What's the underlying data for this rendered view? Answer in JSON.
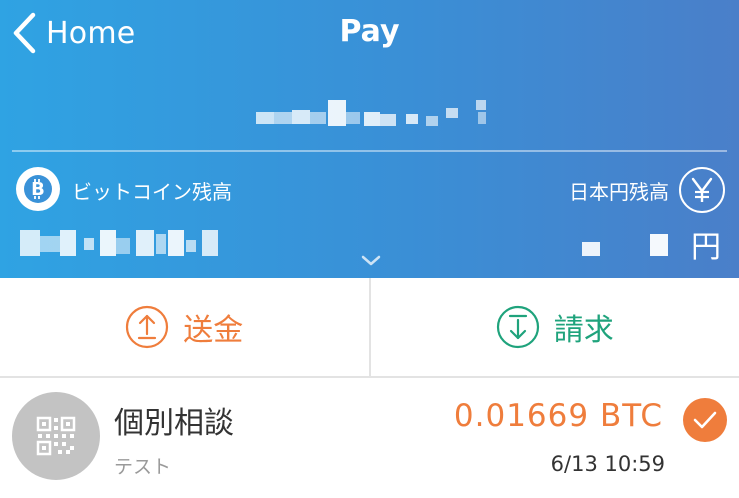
{
  "nav": {
    "back_label": "Home",
    "title": "Pay"
  },
  "balances": {
    "btc": {
      "label": "ビットコイン残高",
      "icon": "bitcoin-icon"
    },
    "jpy": {
      "label": "日本円残高",
      "unit": "円",
      "icon": "yen-icon"
    }
  },
  "actions": {
    "send": {
      "label": "送金",
      "icon": "upload-arrow-icon",
      "color": "#ef7d3c"
    },
    "request": {
      "label": "請求",
      "icon": "download-arrow-icon",
      "color": "#1fa37c"
    }
  },
  "transactions": [
    {
      "title": "個別相談",
      "subtitle": "テスト",
      "amount": "0.01669 BTC",
      "time": "6/13 10:59",
      "icon": "qr-code-icon",
      "status_icon": "checkmark-icon"
    }
  ],
  "colors": {
    "header_gradient_start": "#2fa3e3",
    "header_gradient_end": "#4a7fc9",
    "accent_orange": "#ef7d3c",
    "accent_green": "#1fa37c"
  }
}
